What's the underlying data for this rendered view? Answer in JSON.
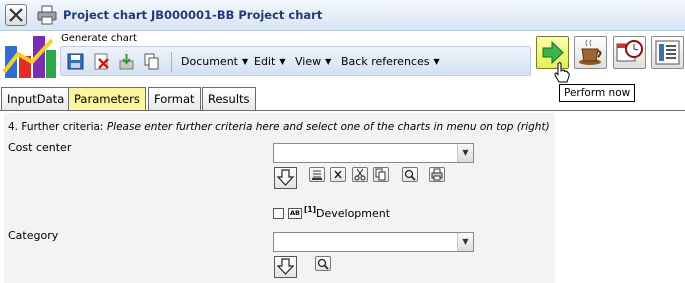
{
  "window": {
    "title": "Project chart JB000001-BB Project chart"
  },
  "toolbar": {
    "group_label": "Generate chart",
    "menus": [
      "Document",
      "Edit",
      "View",
      "Back references"
    ],
    "tooltip": "Perform now"
  },
  "tabs": [
    {
      "label": "InputData",
      "active": false
    },
    {
      "label": "Parameters",
      "active": true
    },
    {
      "label": "Format",
      "active": false
    },
    {
      "label": "Results",
      "active": false
    }
  ],
  "parameters": {
    "criteria_prefix": "4. Further criteria:",
    "criteria_hint": "Please enter further criteria here and select one of the charts in menu on top (right)",
    "cost_center": {
      "label": "Cost center",
      "value": ""
    },
    "development": {
      "checked": false,
      "label": "Development",
      "ab_text": "AB",
      "marker": "[1]"
    },
    "category": {
      "label": "Category",
      "value": ""
    }
  },
  "colors": {
    "title": "#1f3c78",
    "active_tab": "#fbf59e",
    "perform_button": "#e4ef52",
    "toolbar_bg": "#d5e1f1",
    "content_bg": "#f3f3f1"
  }
}
